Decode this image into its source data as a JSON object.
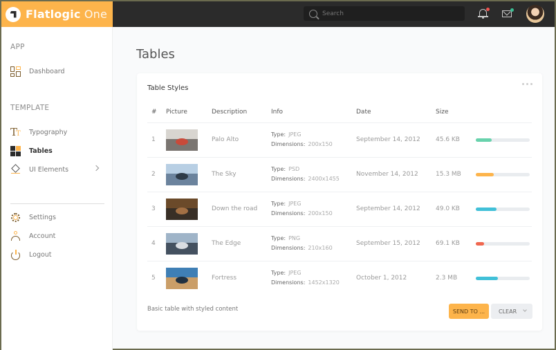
{
  "brand": {
    "name_bold": "Flatlogic",
    "name_light": " One"
  },
  "header": {
    "search_placeholder": "Search",
    "notifications_badge_color": "#f0544f",
    "messages_badge_color": "#3abf94"
  },
  "sidebar": {
    "section_app": "APP",
    "section_template": "TEMPLATE",
    "items": [
      {
        "label": "Dashboard",
        "icon": "dashboard-icon"
      },
      {
        "label": "Typography",
        "icon": "typography-icon"
      },
      {
        "label": "Tables",
        "icon": "tables-icon",
        "active": true
      },
      {
        "label": "UI Elements",
        "icon": "layers-icon",
        "has_submenu": true
      },
      {
        "label": "Settings",
        "icon": "gear-icon"
      },
      {
        "label": "Account",
        "icon": "user-icon"
      },
      {
        "label": "Logout",
        "icon": "power-icon"
      }
    ]
  },
  "page": {
    "title": "Tables"
  },
  "card": {
    "title": "Table Styles",
    "footer_text": "Basic table with styled content",
    "send_label": "SEND TO ...",
    "clear_label": "CLEAR",
    "columns": [
      "#",
      "Picture",
      "Description",
      "Info",
      "Date",
      "Size",
      ""
    ],
    "info_type_label": "Type:",
    "info_dim_label": "Dimensions:",
    "rows": [
      {
        "id": "1",
        "description": "Palo Alto",
        "type": "JPEG",
        "dimensions": "200x150",
        "date": "September 14, 2012",
        "size": "45.6 KB",
        "progress_pct": 29,
        "color": "#68d2ac",
        "thumb": [
          "#d8d5d0",
          "#6a6460",
          "#c94a3a"
        ]
      },
      {
        "id": "2",
        "description": "The Sky",
        "type": "PSD",
        "dimensions": "2400x1455",
        "date": "November 14, 2012",
        "size": "15.3 MB",
        "progress_pct": 33,
        "color": "#fdb44b",
        "thumb": [
          "#b8cfe4",
          "#5d7691",
          "#2e3b48"
        ]
      },
      {
        "id": "3",
        "description": "Down the road",
        "type": "JPEG",
        "dimensions": "200x150",
        "date": "September 14, 2012",
        "size": "49.0 KB",
        "progress_pct": 38,
        "color": "#41c0d8",
        "thumb": [
          "#6b4a2a",
          "#2f2a26",
          "#a37044"
        ]
      },
      {
        "id": "4",
        "description": "The Edge",
        "type": "PNG",
        "dimensions": "210x160",
        "date": "September 15, 2012",
        "size": "69.1 KB",
        "progress_pct": 15,
        "color": "#f0674f",
        "thumb": [
          "#9fb4c8",
          "#34404d",
          "#d9dde2"
        ]
      },
      {
        "id": "5",
        "description": "Fortress",
        "type": "JPEG",
        "dimensions": "1452x1320",
        "date": "October 1, 2012",
        "size": "2.3 MB",
        "progress_pct": 41,
        "color": "#41c0d8",
        "thumb": [
          "#3f7fb5",
          "#e3a35a",
          "#203040"
        ]
      }
    ]
  }
}
